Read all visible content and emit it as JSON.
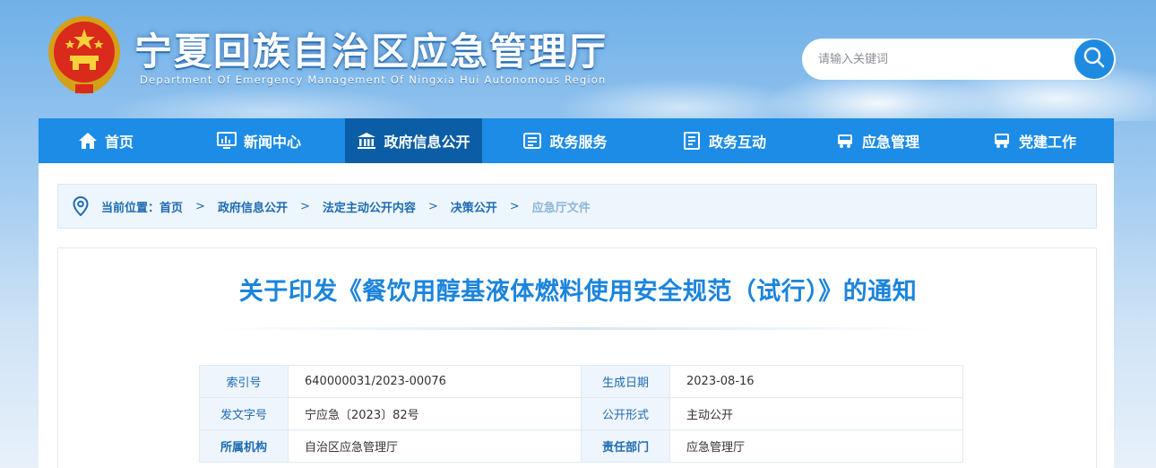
{
  "header": {
    "title": "宁夏回族自治区应急管理厅",
    "subtitle": "Department Of Emergency Management Of Ningxia Hui Autonomous Region",
    "emblem_icon": "national-emblem"
  },
  "search": {
    "placeholder": "请输入关键词",
    "button_icon": "search-icon"
  },
  "nav": {
    "items": [
      {
        "label": "首页",
        "icon": "home-icon",
        "active": false
      },
      {
        "label": "新闻中心",
        "icon": "monitor-chart-icon",
        "active": false
      },
      {
        "label": "政府信息公开",
        "icon": "government-building-icon",
        "active": true
      },
      {
        "label": "政务服务",
        "icon": "service-window-icon",
        "active": false
      },
      {
        "label": "政务互动",
        "icon": "document-list-icon",
        "active": false
      },
      {
        "label": "应急管理",
        "icon": "vehicle-icon",
        "active": false
      },
      {
        "label": "党建工作",
        "icon": "party-vehicle-icon",
        "active": false
      }
    ],
    "colors": {
      "bar": "#1c8ce6",
      "active": "#0b5ea6"
    }
  },
  "breadcrumb": {
    "prefix": "当前位置：",
    "items": [
      "首页",
      "政府信息公开",
      "法定主动公开内容",
      "决策公开",
      "应急厅文件"
    ],
    "separator": ">"
  },
  "article": {
    "title": "关于印发《餐饮用醇基液体燃料使用安全规范（试行）》的通知",
    "meta": [
      {
        "k1": "索引号",
        "v1": "640000031/2023-00076",
        "k2": "生成日期",
        "v2": "2023-08-16"
      },
      {
        "k1": "发文字号",
        "v1": "宁应急〔2023〕82号",
        "k2": "公开形式",
        "v2": "主动公开"
      },
      {
        "k1": "所属机构",
        "v1": "自治区应急管理厅",
        "k2": "责任部门",
        "v2": "应急管理厅"
      }
    ]
  },
  "colors": {
    "accent": "#1b84dc",
    "link": "#1d6bb3"
  }
}
